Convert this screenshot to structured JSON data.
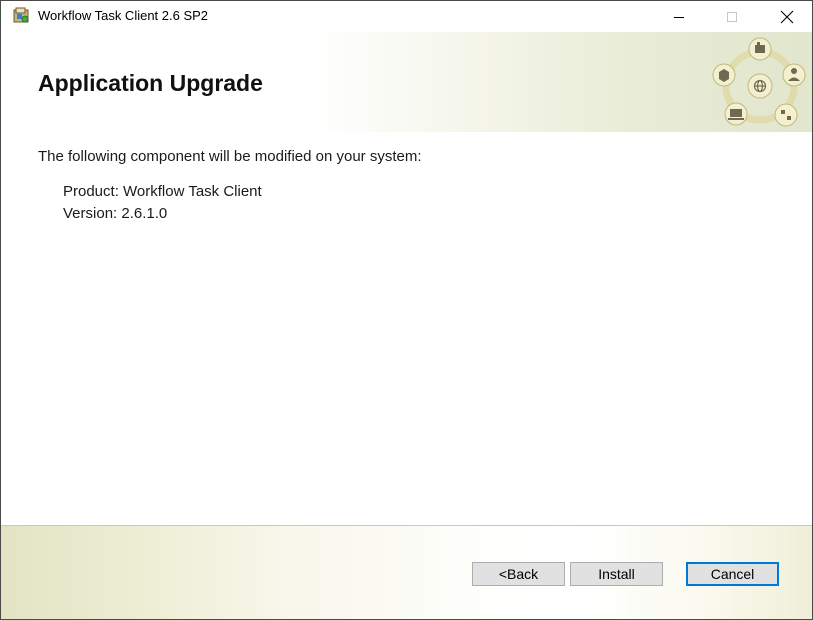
{
  "window": {
    "title": "Workflow Task Client 2.6 SP2",
    "icon": "installer-package-icon"
  },
  "header": {
    "title": "Application Upgrade",
    "logo_icon": "network-components-logo"
  },
  "content": {
    "intro": "The following component will be modified on your system:",
    "product_line": "Product: Workflow Task Client",
    "version_line": "Version:  2.6.1.0"
  },
  "footer": {
    "back_label": "<Back",
    "install_label": "Install",
    "cancel_label": "Cancel"
  },
  "colors": {
    "focus_border": "#0078d7",
    "header_gradient_end": "#e2e6cd"
  }
}
